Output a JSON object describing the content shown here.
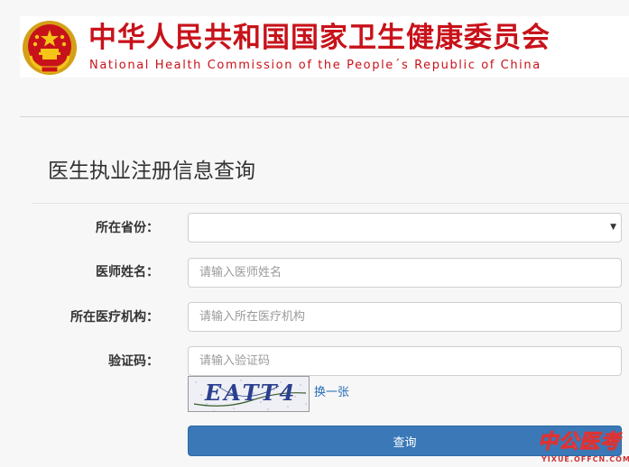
{
  "header": {
    "title_cn": "中华人民共和国国家卫生健康委员会",
    "title_en": "National Health Commission of the People´s Republic of China",
    "brand_color": "#c8121a",
    "emblem_icon": "national-emblem"
  },
  "page": {
    "title": "医生执业注册信息查询"
  },
  "form": {
    "province_label": "所在省份：",
    "province_value": "",
    "name_label": "医师姓名：",
    "name_placeholder": "请输入医师姓名",
    "institution_label": "所在医疗机构：",
    "institution_placeholder": "请输入所在医疗机构",
    "captcha_label": "验证码：",
    "captcha_placeholder": "请输入验证码",
    "captcha_text": "EATT4",
    "refresh_label": "换一张",
    "submit_label": "查询",
    "accent_color": "#3a78b8"
  },
  "watermark": {
    "text_cn": "中公医考",
    "url": "YIXUE.OFFCN.COM"
  }
}
